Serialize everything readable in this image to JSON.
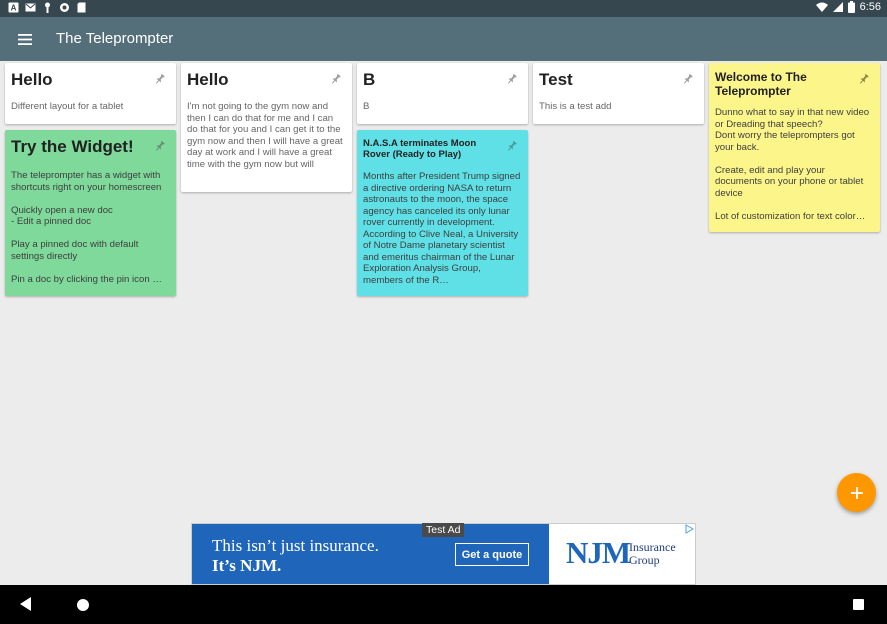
{
  "status_bar": {
    "time": "6:56",
    "left_icons": [
      "a-icon",
      "mail-icon",
      "key-icon",
      "circle-icon",
      "sd-card-icon"
    ],
    "right_icons": [
      "wifi-icon",
      "signal-icon",
      "battery-icon"
    ]
  },
  "app_bar": {
    "title": "The Teleprompter",
    "menu_icon": "hamburger-menu-icon"
  },
  "colors": {
    "app_bar": "#546e7a",
    "status_bar": "#37474f",
    "fab": "#ff9800",
    "green_card": "#7ed99a",
    "cyan_card": "#5ee0e6",
    "yellow_card": "#fbf58a"
  },
  "cards": [
    {
      "title": "Hello",
      "body": "Different layout for a tablet",
      "color": "white"
    },
    {
      "title": "Try the Widget!",
      "body": "The teleprompter has a widget with shortcuts right on your homescreen\n\nQuickly open a new doc\n- Edit a pinned doc\n\nPlay a pinned doc with default settings directly\n\nPin a doc by clicking the pin icon …",
      "color": "green"
    },
    {
      "title": "Hello",
      "body": "I'm not going to the gym now and then I can do that for me and I can do that for you and I can get it to the gym now and then I will have a great day at work and I will have a great time with the gym now but will",
      "color": "white"
    },
    {
      "title": "B",
      "body": "B",
      "color": "white"
    },
    {
      "title": "N.A.S.A terminates Moon Rover (Ready to Play)",
      "body": "Months after President Trump signed a directive ordering NASA to return astronauts to the moon, the space agency has canceled its only lunar rover currently in development. According to Clive Neal, a University of Notre Dame planetary scientist and emeritus chairman of the Lunar Exploration Analysis Group, members of the R…",
      "color": "cyan"
    },
    {
      "title": "Test",
      "body": "This is a test add",
      "color": "white"
    },
    {
      "title": "Welcome to The Teleprompter",
      "body": "Dunno what to say in that new video or Dreading that speech?\nDont worry the teleprompters got your back.\n\nCreate, edit and play your documents on your phone or tablet device\n\nLot of customization for text color…",
      "color": "yellow"
    }
  ],
  "fab": {
    "icon": "plus-icon"
  },
  "ad": {
    "label": "Test Ad",
    "line1": "This isn’t just insurance.",
    "line2": "It’s NJM.",
    "cta": "Get a quote",
    "brand": "NJM",
    "brand_sub1": "Insurance",
    "brand_sub2": "Group"
  },
  "nav_bar": {
    "buttons": [
      "back-icon",
      "home-icon",
      "recents-icon"
    ]
  }
}
